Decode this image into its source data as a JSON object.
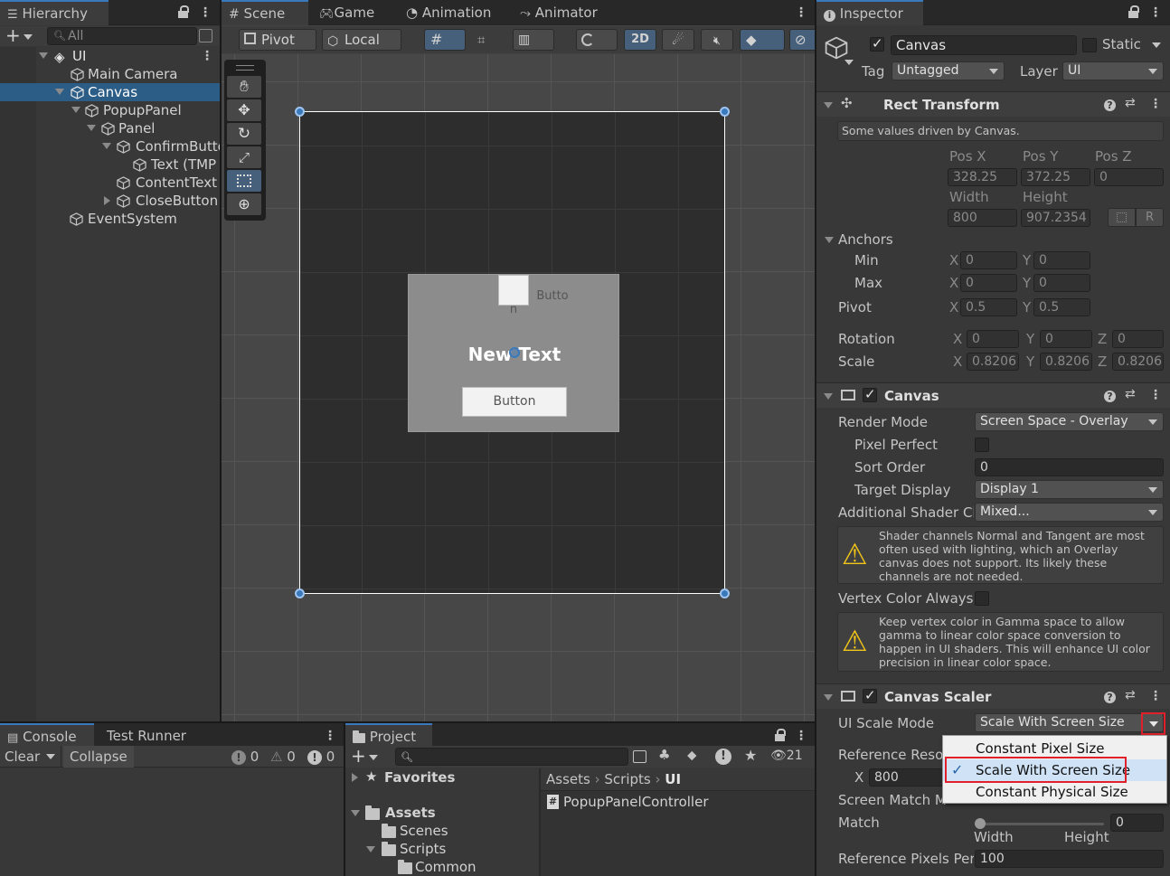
{
  "hierarchy": {
    "tab": "Hierarchy",
    "search_placeholder": "All",
    "items": [
      {
        "label": "UI",
        "depth": 0
      },
      {
        "label": "Main Camera",
        "depth": 1
      },
      {
        "label": "Canvas",
        "depth": 1
      },
      {
        "label": "PopupPanel",
        "depth": 2
      },
      {
        "label": "Panel",
        "depth": 3
      },
      {
        "label": "ConfirmButto",
        "depth": 4
      },
      {
        "label": "Text (TMP",
        "depth": 5
      },
      {
        "label": "ContentText",
        "depth": 4
      },
      {
        "label": "CloseButton",
        "depth": 4
      },
      {
        "label": "EventSystem",
        "depth": 1
      }
    ]
  },
  "scene": {
    "tabs": [
      "Scene",
      "Game",
      "Animation",
      "Animator"
    ],
    "toolbar": {
      "pivot": "Pivot",
      "local": "Local",
      "mode_2d": "2D"
    },
    "popup": {
      "top_button": "Butto\nn",
      "title": "New Text",
      "button": "Button"
    }
  },
  "console": {
    "tabs": [
      "Console",
      "Test Runner"
    ],
    "clear": "Clear",
    "collapse": "Collapse",
    "counts": {
      "info": "0",
      "warn": "0",
      "error": "0"
    }
  },
  "project": {
    "tab": "Project",
    "hidden_count": "21",
    "favorites": "Favorites",
    "assets": "Assets",
    "folders": [
      "Scenes",
      "Scripts",
      "Common"
    ],
    "breadcrumb": [
      "Assets",
      "Scripts",
      "UI"
    ],
    "files": [
      "PopupPanelController"
    ]
  },
  "inspector": {
    "tab": "Inspector",
    "object_name": "Canvas",
    "static_label": "Static",
    "tag_label": "Tag",
    "tag_value": "Untagged",
    "layer_label": "Layer",
    "layer_value": "UI",
    "rect_transform": {
      "title": "Rect Transform",
      "note": "Some values driven by Canvas.",
      "pos_x_label": "Pos X",
      "pos_y_label": "Pos Y",
      "pos_z_label": "Pos Z",
      "pos_x": "328.25",
      "pos_y": "372.25",
      "pos_z": "0",
      "width_label": "Width",
      "height_label": "Height",
      "width": "800",
      "height": "907.2354",
      "r_button": "R",
      "anchors_label": "Anchors",
      "min_label": "Min",
      "max_label": "Max",
      "min_x": "0",
      "min_y": "0",
      "max_x": "0",
      "max_y": "0",
      "pivot_label": "Pivot",
      "pivot_x": "0.5",
      "pivot_y": "0.5",
      "rotation_label": "Rotation",
      "rot_x": "0",
      "rot_y": "0",
      "rot_z": "0",
      "scale_label": "Scale",
      "scale_x": "0.8206",
      "scale_y": "0.8206",
      "scale_z": "0.8206"
    },
    "canvas": {
      "title": "Canvas",
      "render_mode_label": "Render Mode",
      "render_mode": "Screen Space - Overlay",
      "pixel_perfect_label": "Pixel Perfect",
      "sort_order_label": "Sort Order",
      "sort_order": "0",
      "target_display_label": "Target Display",
      "target_display": "Display 1",
      "shader_label": "Additional Shader Ch",
      "shader_value": "Mixed...",
      "shader_warning": "Shader channels Normal and Tangent are most often used with lighting, which an Overlay canvas does not support. Its likely these channels are not needed.",
      "vertex_label": "Vertex Color Always",
      "vertex_warning": "Keep vertex color in Gamma space to allow gamma to linear color space conversion to happen in UI shaders. This will enhance UI color precision in linear color space."
    },
    "canvas_scaler": {
      "title": "Canvas Scaler",
      "ui_scale_mode_label": "UI Scale Mode",
      "ui_scale_mode": "Scale With Screen Size",
      "options": [
        "Constant Pixel Size",
        "Scale With Screen Size",
        "Constant Physical Size"
      ],
      "selected_option": "Scale With Screen Size",
      "ref_res_label": "Reference Reso",
      "ref_x_label": "X",
      "ref_x": "800",
      "match_mode_label": "Screen Match M",
      "match_label": "Match",
      "match_value": "0",
      "width_label": "Width",
      "height_label": "Height",
      "ref_ppu_label": "Reference Pixels Per",
      "ref_ppu": "100"
    }
  },
  "colors": {
    "accent": "#3a79bb",
    "selection": "#2c5d87",
    "highlight": "#e0202a"
  }
}
